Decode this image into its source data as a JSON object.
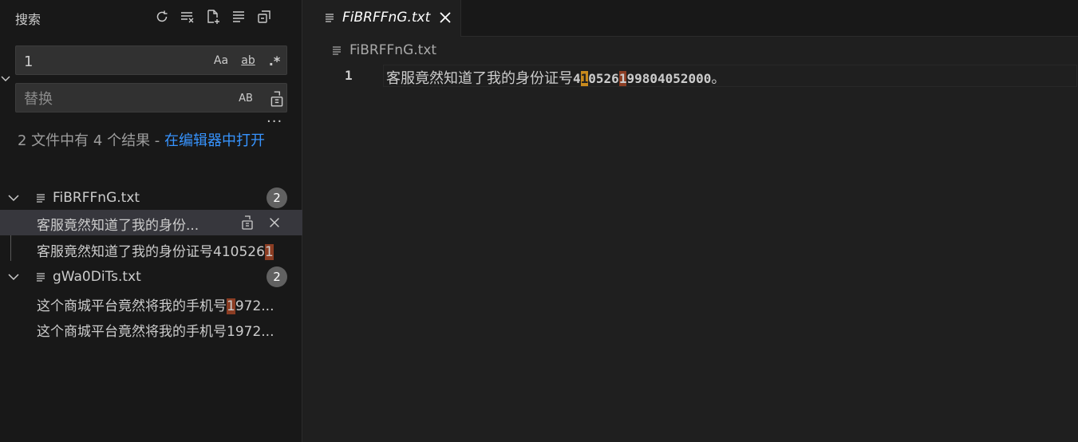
{
  "sidebar": {
    "title": "搜索",
    "search": {
      "value": "1",
      "opt_case": "Aa",
      "opt_word": "ab",
      "opt_regex": ".*"
    },
    "replace": {
      "placeholder": "替换",
      "opt_preserve": "AB"
    },
    "more": "···",
    "summary": {
      "text": "2 文件中有 4 个结果 - ",
      "link": "在编辑器中打开"
    },
    "files": [
      {
        "name": "FiBRFFnG.txt",
        "count": "2",
        "matches": [
          {
            "pre": "客服竟然知道了我的身份...",
            "hit": "",
            "post": ""
          },
          {
            "pre": "客服竟然知道了我的身份证号410526",
            "hit": "1",
            "post": ""
          }
        ]
      },
      {
        "name": "gWa0DiTs.txt",
        "count": "2",
        "matches": [
          {
            "pre": "这个商城平台竟然将我的手机号",
            "hit": "1",
            "post": "972..."
          },
          {
            "pre": "这个商城平台竟然将我的手机号1972...",
            "hit": "",
            "post": ""
          }
        ]
      }
    ]
  },
  "editor": {
    "tab_label": "FiBRFFnG.txt",
    "breadcrumb": "FiBRFFnG.txt",
    "line_number": "1",
    "line": {
      "prefix": "客服竟然知道了我的身份证号",
      "d1": "4",
      "m1": "1",
      "d2": "0526",
      "m2": "1",
      "d3": "99804052000",
      "suffix": "。"
    }
  },
  "colors": {
    "accent_link": "#3794ff",
    "match_current": "#c98a1c",
    "match_other": "#8b3d23"
  }
}
